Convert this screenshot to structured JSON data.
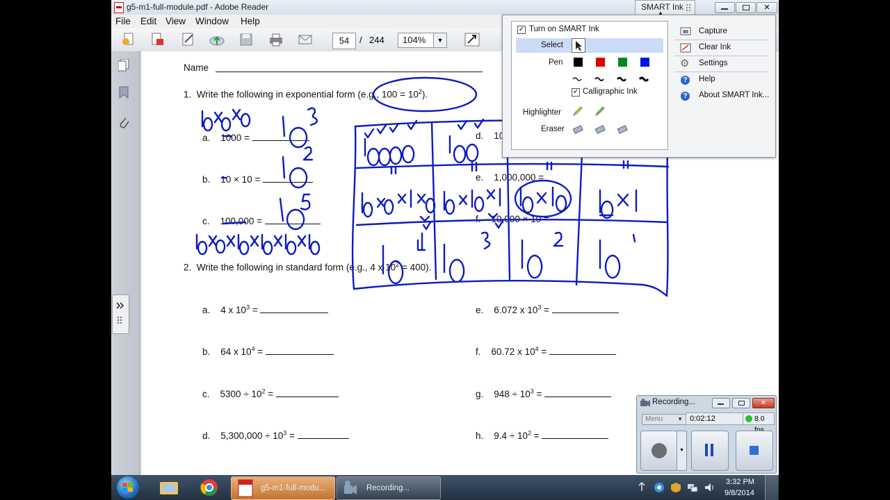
{
  "window": {
    "title": "g5-m1-full-module.pdf - Adobe Reader"
  },
  "menu": [
    "File",
    "Edit",
    "View",
    "Window",
    "Help"
  ],
  "toolbar": {
    "page_current": "54",
    "page_sep": "/",
    "page_total": "244",
    "zoom": "104%"
  },
  "worksheet": {
    "name_label": "Name",
    "q1": {
      "number": "1.",
      "text": "Write the following in exponential form (e.g., 100 = 10",
      "exp": "2",
      "end": ")."
    },
    "q1_items": [
      {
        "letter": "a.",
        "expr": "1000 = "
      },
      {
        "letter": "b.",
        "expr": "10 × 10 = "
      },
      {
        "letter": "c.",
        "expr": "100,000 = "
      },
      {
        "letter": "d.",
        "expr": "10"
      },
      {
        "letter": "e.",
        "expr": "1,000,000 = "
      },
      {
        "letter": "f.",
        "expr": "10,000 × 10 = "
      }
    ],
    "q2": {
      "number": "2.",
      "text": "Write the following in standard form (e.g., 4 x 10",
      "exp": "2",
      "end": " = 400)."
    },
    "q2_left": [
      {
        "letter": "a.",
        "pre": "4 x 10",
        "exp": "3",
        "post": " = "
      },
      {
        "letter": "b.",
        "pre": "64 x 10",
        "exp": "4",
        "post": " = "
      },
      {
        "letter": "c.",
        "pre": "5300 ÷ 10",
        "exp": "2",
        "post": " = "
      },
      {
        "letter": "d.",
        "pre": "5,300,000  ÷ 10",
        "exp": "3",
        "post": " = "
      }
    ],
    "q2_right": [
      {
        "letter": "e.",
        "pre": "6.072 x 10",
        "exp": "3",
        "post": " = "
      },
      {
        "letter": "f.",
        "pre": "60.72 x 10",
        "exp": "4",
        "post": " = "
      },
      {
        "letter": "g.",
        "pre": "948  ÷  10",
        "exp": "3",
        "post": " = "
      },
      {
        "letter": "h.",
        "pre": "9.4  ÷ 10",
        "exp": "2",
        "post": " = "
      }
    ]
  },
  "smart_ink": {
    "tab_label": "SMART Ink",
    "turn_on": "Turn on SMART Ink",
    "select": "Select",
    "pen": "Pen",
    "pen_colors": [
      "#000000",
      "#e00000",
      "#008a1e",
      "#0018e0"
    ],
    "calligraphic": "Calligraphic Ink",
    "highlighter": "Highlighter",
    "eraser": "Eraser",
    "menu": [
      "Capture",
      "Clear Ink",
      "Settings",
      "Help",
      "About SMART Ink..."
    ]
  },
  "recorder": {
    "title": "Recording...",
    "menu": "Menu",
    "elapsed": "0:02:12",
    "fps": "8.0 fps"
  },
  "taskbar": {
    "tasks": [
      "g5-m1-full-modu...",
      "Recording..."
    ],
    "time": "3:32 PM",
    "date": "9/8/2014"
  },
  "colors": {
    "ink": "#0d1bbf",
    "title_bg": "#dfe6ef",
    "page": "#ffffff",
    "taskbar": "#2c3c4e"
  }
}
